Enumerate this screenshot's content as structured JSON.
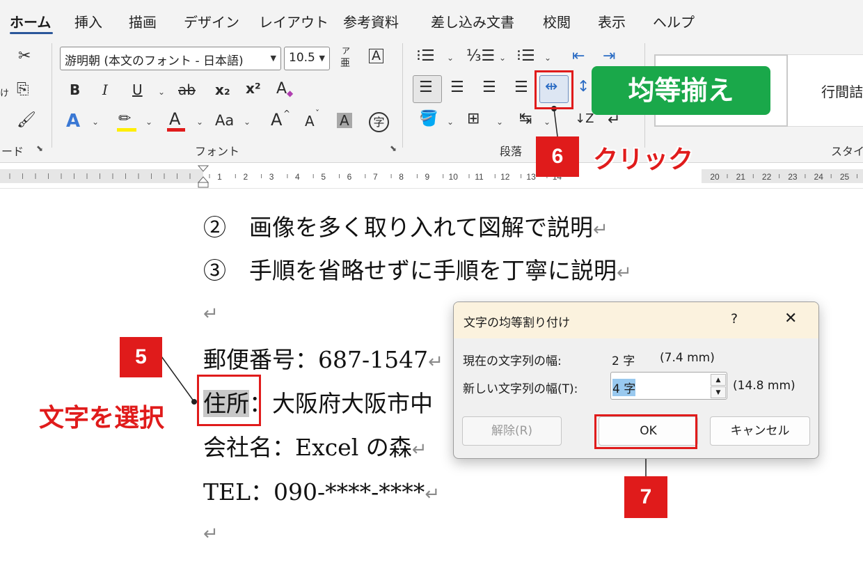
{
  "tabs": [
    "ホーム",
    "挿入",
    "描画",
    "デザイン",
    "レイアウト",
    "参考資料",
    "差し込み文書",
    "校閲",
    "表示",
    "ヘルプ"
  ],
  "ribbon": {
    "clipboard_label": "ード",
    "clipboard_partial": "け",
    "font_name": "游明朝 (本文のフォント - 日本語)",
    "font_size": "10.5",
    "font_group_label": "フォント",
    "paragraph_group_label": "段落",
    "style_preview": "行間詰",
    "style_group_label": "スタイ",
    "bold": "B",
    "italic": "I",
    "underline": "U",
    "strike": "ab",
    "subscript": "x₂",
    "superscript": "x²",
    "clear_format": "A",
    "text_effect": "A",
    "font_color": "A",
    "change_case": "Aa",
    "grow_font": "A",
    "shrink_font": "A",
    "char_shading": "A",
    "enclose": "字",
    "phonetic_top": "ア",
    "phonetic_bottom": "亜",
    "char_border": "A"
  },
  "ruler": {
    "left_ticks": [
      "1",
      "2",
      "3",
      "4",
      "5",
      "6",
      "7",
      "8",
      "9",
      "10",
      "11",
      "12",
      "13",
      "14"
    ],
    "right_ticks": [
      "20",
      "21",
      "22",
      "23",
      "24",
      "25"
    ]
  },
  "document": {
    "line1": "②　画像を多く取り入れて図解で説明",
    "line2": "③　手順を省略せずに手順を丁寧に説明",
    "return_mark": "↵",
    "postal": "郵便番号：687-1547",
    "address_selected": "住所",
    "address_rest": "：大阪府大阪市中",
    "company": "会社名：Excel の森",
    "tel": "TEL：090-****-****"
  },
  "annotations": {
    "badge_title": "均等揃え",
    "click_label": "クリック",
    "select_label": "文字を選択",
    "step5": "5",
    "step6": "6",
    "step7": "7"
  },
  "dialog": {
    "title": "文字の均等割り付け",
    "help": "?",
    "close": "✕",
    "current_label": "現在の文字列の幅:",
    "current_value": "2 字",
    "current_mm": "(7.4 mm)",
    "new_label": "新しい文字列の幅(T):",
    "new_value": "4 字",
    "new_mm": "(14.8 mm)",
    "release_button": "解除(R)",
    "ok_button": "OK",
    "cancel_button": "キャンセル"
  },
  "colors": {
    "annotation_red": "#e01b1b",
    "badge_green": "#1aa84a",
    "word_blue": "#2b579a",
    "dialog_title_bg": "#fbf2de"
  }
}
